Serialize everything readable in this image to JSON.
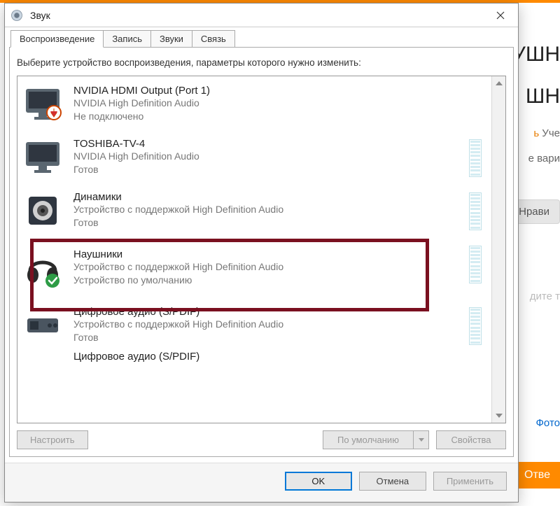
{
  "background": {
    "heading1": "УШН",
    "heading2": "ШН",
    "study_link": "ь",
    "study_text": " Уче",
    "variants": "е вари",
    "like": "Нрави",
    "hint": "дите т",
    "photo": "Фото",
    "answer": "Отве"
  },
  "dialog": {
    "title": "Звук",
    "tabs": [
      "Воспроизведение",
      "Запись",
      "Звуки",
      "Связь"
    ],
    "instruction": "Выберите устройство воспроизведения, параметры которого нужно изменить:",
    "devices": [
      {
        "name": "NVIDIA HDMI Output (Port 1)",
        "sub1": "NVIDIA High Definition Audio",
        "sub2": "Не подключено",
        "has_meter": false,
        "icon": "monitor-disconnected"
      },
      {
        "name": "TOSHIBA-TV-4",
        "sub1": "NVIDIA High Definition Audio",
        "sub2": "Готов",
        "has_meter": true,
        "icon": "monitor"
      },
      {
        "name": "Динамики",
        "sub1": "Устройство с поддержкой High Definition Audio",
        "sub2": "Готов",
        "has_meter": true,
        "icon": "speaker"
      },
      {
        "name": "Наушники",
        "sub1": "Устройство с поддержкой High Definition Audio",
        "sub2": "Устройство по умолчанию",
        "has_meter": true,
        "icon": "headphones-default"
      },
      {
        "name": "Цифровое аудио (S/PDIF)",
        "sub1": "Устройство с поддержкой High Definition Audio",
        "sub2": "Готов",
        "has_meter": true,
        "icon": "spdif"
      },
      {
        "name": "Цифровое аудио (S/PDIF)",
        "sub1": "",
        "sub2": "",
        "has_meter": false,
        "icon": "spdif",
        "partial": true
      }
    ],
    "buttons": {
      "configure": "Настроить",
      "default_split": "По умолчанию",
      "properties": "Свойства",
      "ok": "OK",
      "cancel": "Отмена",
      "apply": "Применить"
    }
  }
}
